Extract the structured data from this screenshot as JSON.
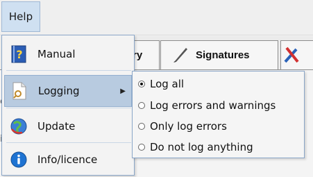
{
  "menubar": {
    "help_label": "Help"
  },
  "tabs": [
    {
      "label": "ry"
    },
    {
      "label": "Signatures"
    }
  ],
  "help_menu": {
    "items": [
      {
        "label": "Manual"
      },
      {
        "label": "Logging"
      },
      {
        "label": "Update"
      },
      {
        "label": "Info/licence"
      }
    ]
  },
  "logging_submenu": {
    "selected": "Log all",
    "options": [
      {
        "label": "Log all"
      },
      {
        "label": "Log errors and warnings"
      },
      {
        "label": "Only log errors"
      },
      {
        "label": "Do not log anything"
      }
    ]
  },
  "icons": {
    "manual": "help-book-icon",
    "logging": "document-search-icon",
    "update": "globe-update-icon",
    "info": "info-icon",
    "signatures": "pen-icon"
  }
}
